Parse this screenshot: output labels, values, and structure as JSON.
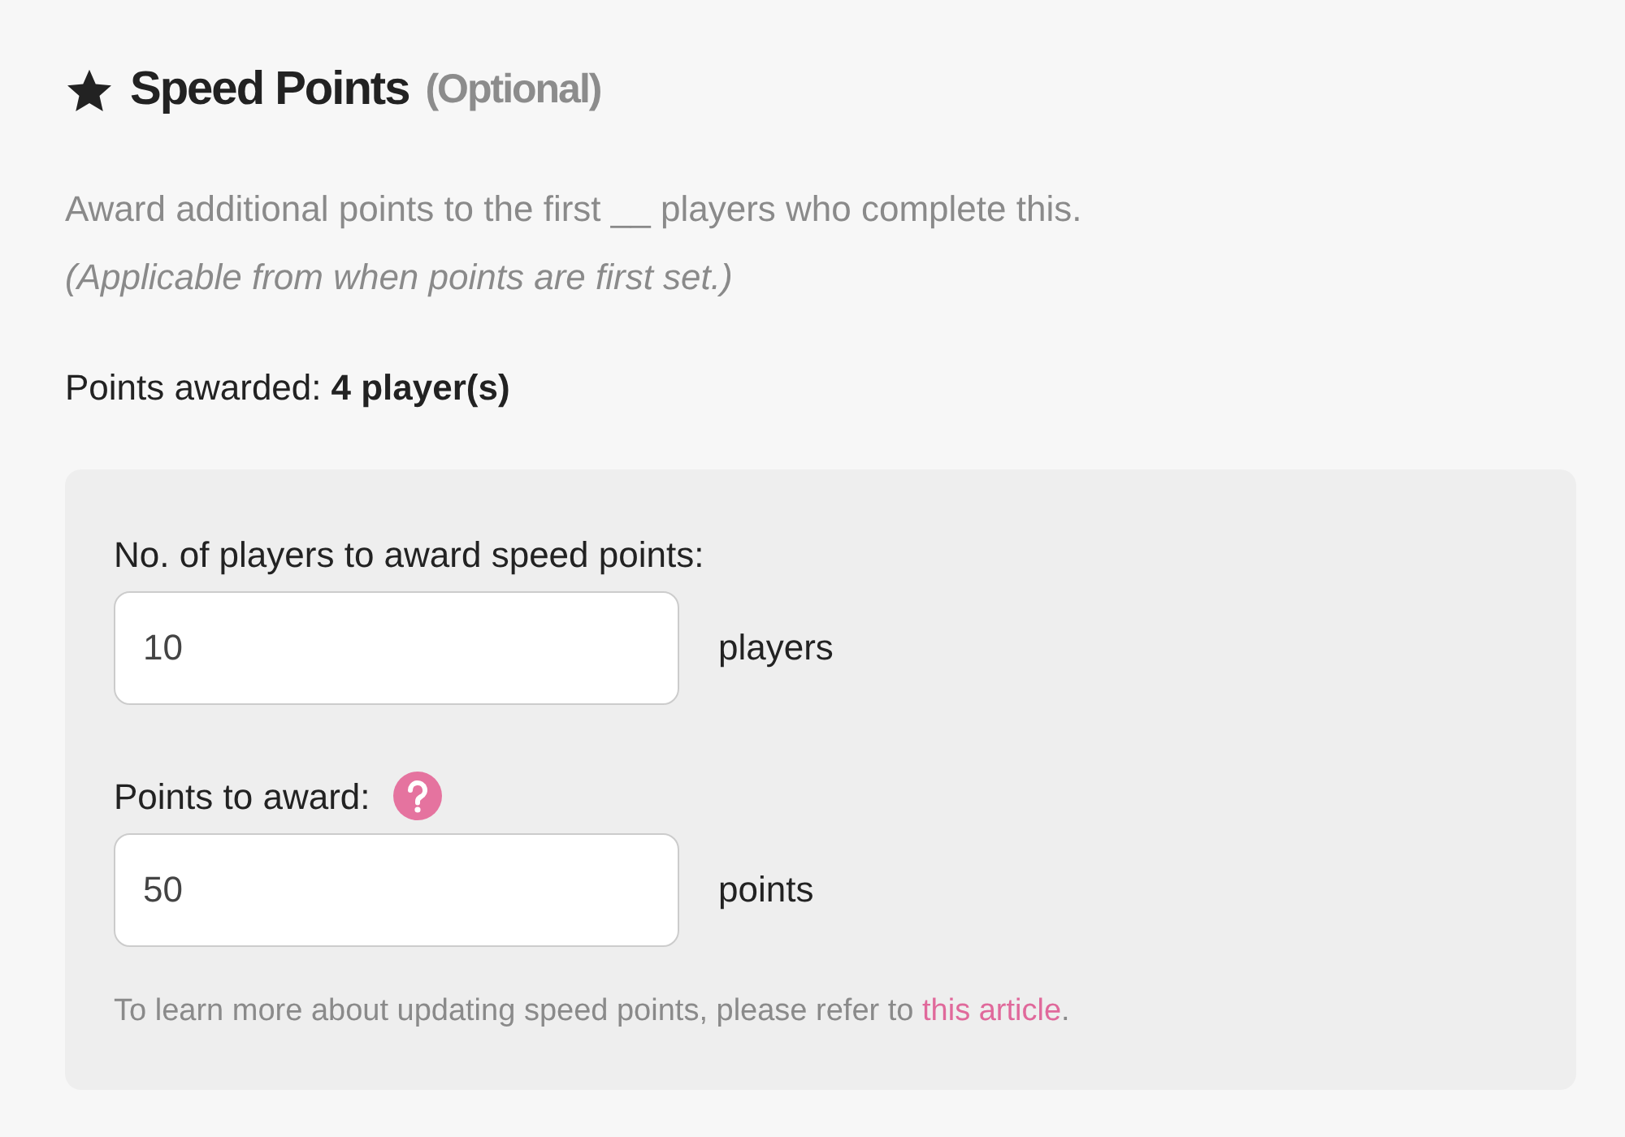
{
  "heading": {
    "title": "Speed Points",
    "note": "(Optional)"
  },
  "description": "Award additional points to the first __ players who complete this.",
  "description_note": "(Applicable from when points are first set.)",
  "points_awarded": {
    "label": "Points awarded:",
    "value": "4 player(s)"
  },
  "fields": [
    {
      "label": "No. of players to award speed points:",
      "value": "10",
      "unit": "players",
      "help": false
    },
    {
      "label": "Points to award:",
      "value": "50",
      "unit": "points",
      "help": true
    }
  ],
  "footer": {
    "text": "To learn more about updating speed points, please refer to",
    "link": "this article",
    "end": "."
  }
}
